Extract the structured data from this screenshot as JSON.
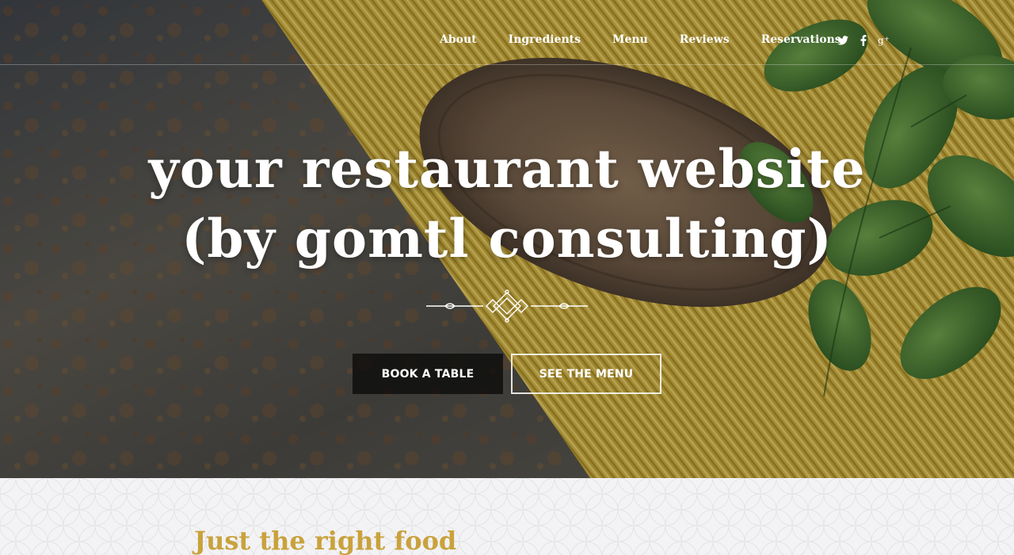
{
  "nav": {
    "links": [
      "About",
      "Ingredients",
      "Menu",
      "Reviews",
      "Reservations"
    ],
    "social": [
      "twitter-icon",
      "facebook-icon",
      "google-plus-icon"
    ]
  },
  "hero": {
    "title_line1": "your restaurant website",
    "title_line2": "(by gomtl consulting)",
    "book_button": "BOOK A TABLE",
    "menu_button": "SEE THE MENU"
  },
  "section": {
    "heading": "Just the right food"
  },
  "colors": {
    "accent": "#c9a23c",
    "hero_text": "#ffffff",
    "section_bg": "#f3f3f5",
    "book_button_bg": "#0a0a0a"
  }
}
